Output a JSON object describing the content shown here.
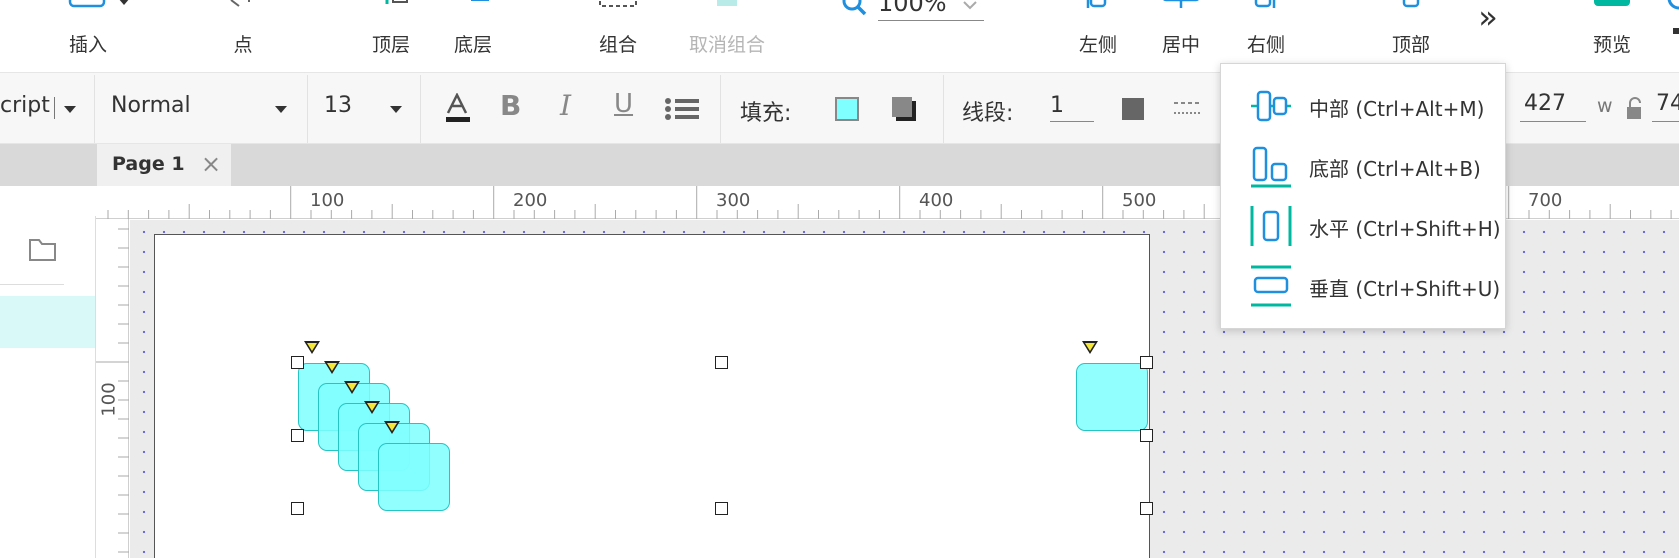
{
  "toolbar": {
    "insert": "插入",
    "point": "点",
    "top_layer": "顶层",
    "bottom_layer": "底层",
    "group": "组合",
    "ungroup": "取消组合",
    "zoom": "100%",
    "align_left": "左侧",
    "align_center": "居中",
    "align_right": "右侧",
    "align_top": "顶部",
    "more": "»",
    "preview": "预览"
  },
  "formatbar": {
    "script_value": "cript",
    "style_value": "Normal",
    "font_size": "13",
    "fill_label": "填充:",
    "stroke_label": "线段:",
    "stroke_width": "1",
    "x_value": "427",
    "w_label": "w",
    "w_value": "74"
  },
  "page_tab": {
    "label": "Page 1",
    "close": "×"
  },
  "ruler": {
    "h_labels": [
      "100",
      "200",
      "300",
      "400",
      "500",
      "700"
    ],
    "v_labels": [
      "100"
    ]
  },
  "dropdown": {
    "items": [
      {
        "label": "中部 (Ctrl+Alt+M)"
      },
      {
        "label": "底部 (Ctrl+Alt+B)"
      },
      {
        "label": "水平 (Ctrl+Shift+H)"
      },
      {
        "label": "垂直 (Ctrl+Shift+U)"
      }
    ]
  },
  "colors": {
    "accent": "#00b8a0",
    "align_blue": "#1f8fe0",
    "shape_fill": "#7fffff",
    "shape_border": "#27c4c4",
    "sidebar_selected": "#d9f8f8"
  }
}
